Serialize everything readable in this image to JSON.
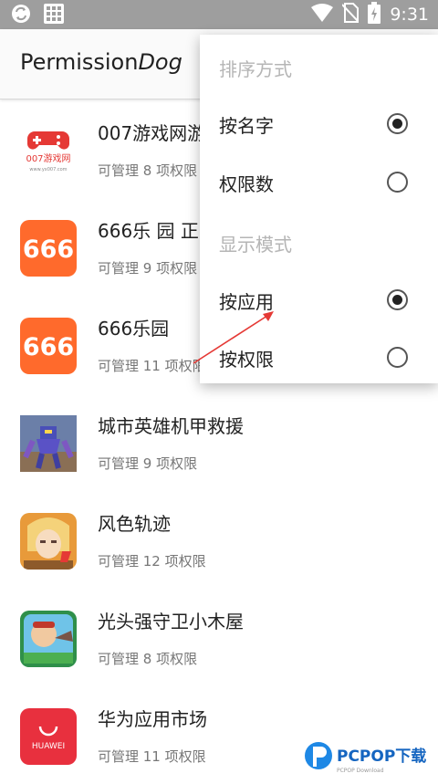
{
  "status_bar": {
    "time": "9:31",
    "icons": [
      "sync-icon",
      "grid-icon",
      "wifi-icon",
      "no-sim-icon",
      "battery-icon"
    ],
    "color": "#9e9e9e"
  },
  "app_bar": {
    "title_plain": "Permission",
    "title_italic": "Dog"
  },
  "apps": [
    {
      "name": "007游戏网游",
      "sub": "可管理 8 项权限",
      "icon": "gamepad-icon",
      "icon_text": "007游戏网",
      "icon_text2": "www.yx007.com"
    },
    {
      "name": "666乐 园 正",
      "sub": "可管理 9 项权限",
      "icon": "666-icon",
      "icon_text": "666"
    },
    {
      "name": "666乐园",
      "sub": "可管理 11 项权限",
      "icon": "666-icon",
      "icon_text": "666"
    },
    {
      "name": "城市英雄机甲救援",
      "sub": "可管理 9 项权限",
      "icon": "robot-game-icon"
    },
    {
      "name": "风色轨迹",
      "sub": "可管理 12 项权限",
      "icon": "anime-game-icon"
    },
    {
      "name": "光头强守卫小木屋",
      "sub": "可管理 8 项权限",
      "icon": "bear-game-icon"
    },
    {
      "name": "华为应用市场",
      "sub": "可管理 11 项权限",
      "icon": "huawei-icon",
      "icon_text": "HUAWEI"
    }
  ],
  "menu": {
    "sort_header": "排序方式",
    "sort_options": [
      {
        "label": "按名字",
        "selected": true
      },
      {
        "label": "权限数",
        "selected": false
      }
    ],
    "display_header": "显示模式",
    "display_options": [
      {
        "label": "按应用",
        "selected": true
      },
      {
        "label": "按权限",
        "selected": false
      }
    ]
  },
  "watermark": {
    "text": "PCPOP下载",
    "subtext": "PCPOP Download"
  },
  "colors": {
    "orange": "#ff6a2c",
    "huawei_red": "#e8303e",
    "arrow": "#e53935"
  }
}
